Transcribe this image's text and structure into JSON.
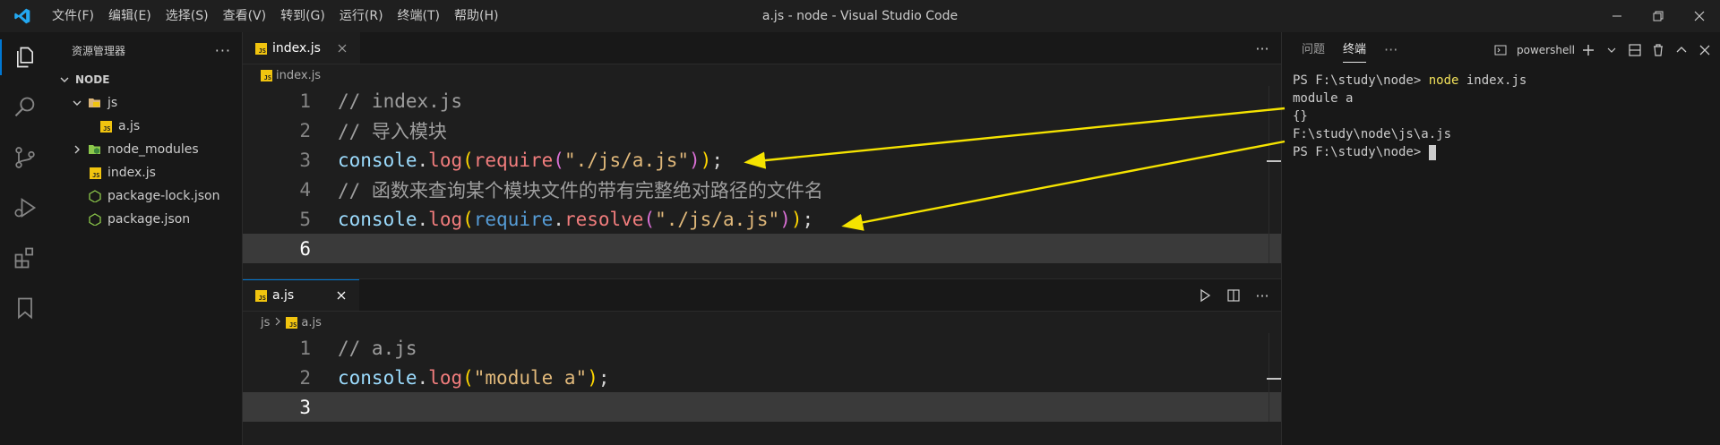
{
  "window": {
    "title": "a.js - node - Visual Studio Code",
    "menu": [
      "文件(F)",
      "编辑(E)",
      "选择(S)",
      "查看(V)",
      "转到(G)",
      "运行(R)",
      "终端(T)",
      "帮助(H)"
    ]
  },
  "explorer": {
    "title": "资源管理器",
    "root": "NODE",
    "items": [
      {
        "label": "js",
        "kind": "folder-open"
      },
      {
        "label": "a.js",
        "kind": "js-file"
      },
      {
        "label": "node_modules",
        "kind": "folder-closed"
      },
      {
        "label": "index.js",
        "kind": "js-file"
      },
      {
        "label": "package-lock.json",
        "kind": "node-file"
      },
      {
        "label": "package.json",
        "kind": "node-file"
      }
    ]
  },
  "editor_top": {
    "tab": "index.js",
    "breadcrumb": "index.js",
    "line_numbers": [
      "1",
      "2",
      "3",
      "4",
      "5",
      "6"
    ],
    "lines": {
      "l1": "// index.js",
      "l2": "// 导入模块",
      "l3a": "console",
      "l3b": ".",
      "l3c": "log",
      "l3d": "(",
      "l3e": "require",
      "l3f": "(",
      "l3g": "\"./js/a.js\"",
      "l3h": ")",
      "l3i": ")",
      "l3j": ";",
      "l4": "// 函数来查询某个模块文件的带有完整绝对路径的文件名",
      "l5a": "console",
      "l5b": ".",
      "l5c": "log",
      "l5d": "(",
      "l5e": "require",
      "l5f": ".",
      "l5g": "resolve",
      "l5h": "(",
      "l5i": "\"./js/a.js\"",
      "l5j": ")",
      "l5k": ")",
      "l5l": ";"
    }
  },
  "editor_bottom": {
    "tab": "a.js",
    "breadcrumb_folder": "js",
    "breadcrumb_file": "a.js",
    "line_numbers": [
      "1",
      "2",
      "3"
    ],
    "lines": {
      "l1": "// a.js",
      "l2a": "console",
      "l2b": ".",
      "l2c": "log",
      "l2d": "(",
      "l2e": "\"module a\"",
      "l2f": ")",
      "l2g": ";"
    }
  },
  "panel": {
    "tabs": [
      "问题",
      "终端"
    ],
    "active_tab": "终端",
    "shell": "powershell",
    "terminal": {
      "l1_prompt": "PS F:\\study\\node> ",
      "l1_cmd": "node",
      "l1_rest": " index.js",
      "l2": "module a",
      "l3": "{}",
      "l4": "F:\\study\\node\\js\\a.js",
      "l5": "PS F:\\study\\node> "
    }
  },
  "colors": {
    "accent": "#0078d4",
    "annotation_arrow": "#f5e300",
    "js_badge": "#f1c40f",
    "node_green": "#8cc84b"
  }
}
